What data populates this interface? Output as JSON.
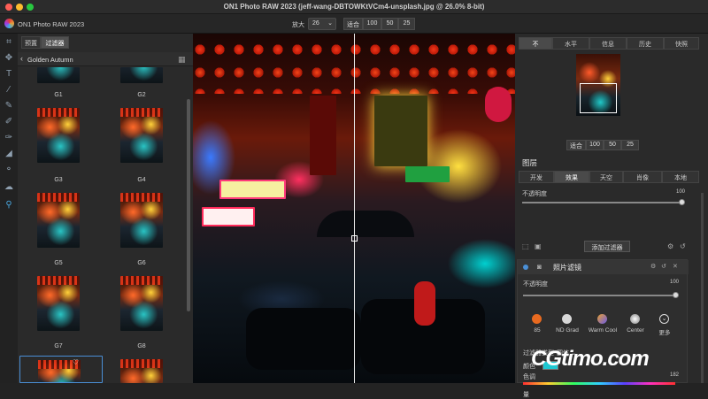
{
  "window": {
    "title": "ON1 Photo RAW 2023 (jeff-wang-DBTOWKtVCm4-unsplash.jpg @ 26.0% 8-bit)"
  },
  "toolbar": {
    "app_name": "ON1 Photo RAW 2023",
    "zoom_label": "放大",
    "zoom_value": "26",
    "zoom_buttons": [
      "适合",
      "100",
      "50",
      "25"
    ]
  },
  "left_panel": {
    "tabs": [
      "预置",
      "过滤器"
    ],
    "folder_name": "Golden Autumn",
    "thumbnails": [
      "G1",
      "G2",
      "G3",
      "G4",
      "G5",
      "G6",
      "G7",
      "G8"
    ]
  },
  "right_panel": {
    "top_tabs": [
      "不",
      "水平",
      "信息",
      "历史",
      "快照"
    ],
    "nav_zoom_buttons": [
      "适合",
      "100",
      "50",
      "25"
    ],
    "layers_title": "图层",
    "layer_tabs": [
      "开发",
      "效果",
      "天空",
      "肖像",
      "本地"
    ],
    "opacity_label": "不透明度",
    "opacity_value": "100",
    "add_filter_label": "添加过滤器",
    "filter": {
      "title": "照片滤镜",
      "opacity_label": "不透明度",
      "opacity_value": "100",
      "presets": [
        "85",
        "ND Grad",
        "Warm Cool",
        "Center",
        "更多"
      ],
      "filter_type_label": "过滤器类型",
      "filter_type_value": "圆体",
      "color_label": "颜色",
      "hue_label": "色调",
      "hue_value": "182",
      "amount_label": "量"
    }
  },
  "colors": {
    "accent": "#4a8fd6",
    "swatch": "#1ec8d2"
  },
  "watermark": "CGtimo.com"
}
